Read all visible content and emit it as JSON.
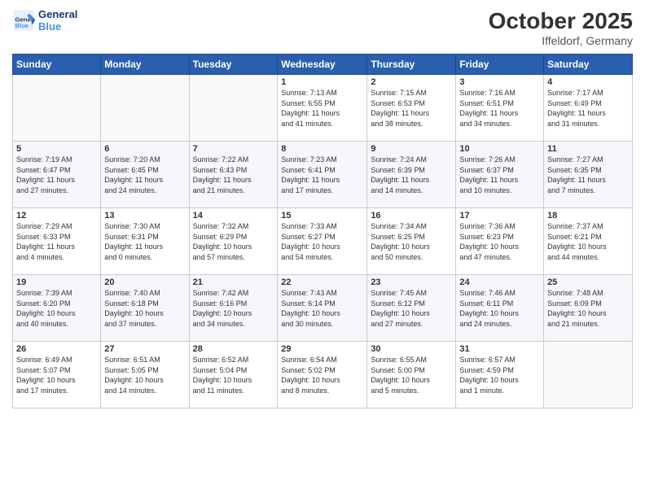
{
  "header": {
    "logo_line1": "General",
    "logo_line2": "Blue",
    "month_year": "October 2025",
    "location": "Iffeldorf, Germany"
  },
  "days_of_week": [
    "Sunday",
    "Monday",
    "Tuesday",
    "Wednesday",
    "Thursday",
    "Friday",
    "Saturday"
  ],
  "weeks": [
    [
      {
        "num": "",
        "info": ""
      },
      {
        "num": "",
        "info": ""
      },
      {
        "num": "",
        "info": ""
      },
      {
        "num": "1",
        "info": "Sunrise: 7:13 AM\nSunset: 6:55 PM\nDaylight: 11 hours\nand 41 minutes."
      },
      {
        "num": "2",
        "info": "Sunrise: 7:15 AM\nSunset: 6:53 PM\nDaylight: 11 hours\nand 38 minutes."
      },
      {
        "num": "3",
        "info": "Sunrise: 7:16 AM\nSunset: 6:51 PM\nDaylight: 11 hours\nand 34 minutes."
      },
      {
        "num": "4",
        "info": "Sunrise: 7:17 AM\nSunset: 6:49 PM\nDaylight: 11 hours\nand 31 minutes."
      }
    ],
    [
      {
        "num": "5",
        "info": "Sunrise: 7:19 AM\nSunset: 6:47 PM\nDaylight: 11 hours\nand 27 minutes."
      },
      {
        "num": "6",
        "info": "Sunrise: 7:20 AM\nSunset: 6:45 PM\nDaylight: 11 hours\nand 24 minutes."
      },
      {
        "num": "7",
        "info": "Sunrise: 7:22 AM\nSunset: 6:43 PM\nDaylight: 11 hours\nand 21 minutes."
      },
      {
        "num": "8",
        "info": "Sunrise: 7:23 AM\nSunset: 6:41 PM\nDaylight: 11 hours\nand 17 minutes."
      },
      {
        "num": "9",
        "info": "Sunrise: 7:24 AM\nSunset: 6:39 PM\nDaylight: 11 hours\nand 14 minutes."
      },
      {
        "num": "10",
        "info": "Sunrise: 7:26 AM\nSunset: 6:37 PM\nDaylight: 11 hours\nand 10 minutes."
      },
      {
        "num": "11",
        "info": "Sunrise: 7:27 AM\nSunset: 6:35 PM\nDaylight: 11 hours\nand 7 minutes."
      }
    ],
    [
      {
        "num": "12",
        "info": "Sunrise: 7:29 AM\nSunset: 6:33 PM\nDaylight: 11 hours\nand 4 minutes."
      },
      {
        "num": "13",
        "info": "Sunrise: 7:30 AM\nSunset: 6:31 PM\nDaylight: 11 hours\nand 0 minutes."
      },
      {
        "num": "14",
        "info": "Sunrise: 7:32 AM\nSunset: 6:29 PM\nDaylight: 10 hours\nand 57 minutes."
      },
      {
        "num": "15",
        "info": "Sunrise: 7:33 AM\nSunset: 6:27 PM\nDaylight: 10 hours\nand 54 minutes."
      },
      {
        "num": "16",
        "info": "Sunrise: 7:34 AM\nSunset: 6:25 PM\nDaylight: 10 hours\nand 50 minutes."
      },
      {
        "num": "17",
        "info": "Sunrise: 7:36 AM\nSunset: 6:23 PM\nDaylight: 10 hours\nand 47 minutes."
      },
      {
        "num": "18",
        "info": "Sunrise: 7:37 AM\nSunset: 6:21 PM\nDaylight: 10 hours\nand 44 minutes."
      }
    ],
    [
      {
        "num": "19",
        "info": "Sunrise: 7:39 AM\nSunset: 6:20 PM\nDaylight: 10 hours\nand 40 minutes."
      },
      {
        "num": "20",
        "info": "Sunrise: 7:40 AM\nSunset: 6:18 PM\nDaylight: 10 hours\nand 37 minutes."
      },
      {
        "num": "21",
        "info": "Sunrise: 7:42 AM\nSunset: 6:16 PM\nDaylight: 10 hours\nand 34 minutes."
      },
      {
        "num": "22",
        "info": "Sunrise: 7:43 AM\nSunset: 6:14 PM\nDaylight: 10 hours\nand 30 minutes."
      },
      {
        "num": "23",
        "info": "Sunrise: 7:45 AM\nSunset: 6:12 PM\nDaylight: 10 hours\nand 27 minutes."
      },
      {
        "num": "24",
        "info": "Sunrise: 7:46 AM\nSunset: 6:11 PM\nDaylight: 10 hours\nand 24 minutes."
      },
      {
        "num": "25",
        "info": "Sunrise: 7:48 AM\nSunset: 6:09 PM\nDaylight: 10 hours\nand 21 minutes."
      }
    ],
    [
      {
        "num": "26",
        "info": "Sunrise: 6:49 AM\nSunset: 5:07 PM\nDaylight: 10 hours\nand 17 minutes."
      },
      {
        "num": "27",
        "info": "Sunrise: 6:51 AM\nSunset: 5:05 PM\nDaylight: 10 hours\nand 14 minutes."
      },
      {
        "num": "28",
        "info": "Sunrise: 6:52 AM\nSunset: 5:04 PM\nDaylight: 10 hours\nand 11 minutes."
      },
      {
        "num": "29",
        "info": "Sunrise: 6:54 AM\nSunset: 5:02 PM\nDaylight: 10 hours\nand 8 minutes."
      },
      {
        "num": "30",
        "info": "Sunrise: 6:55 AM\nSunset: 5:00 PM\nDaylight: 10 hours\nand 5 minutes."
      },
      {
        "num": "31",
        "info": "Sunrise: 6:57 AM\nSunset: 4:59 PM\nDaylight: 10 hours\nand 1 minute."
      },
      {
        "num": "",
        "info": ""
      }
    ]
  ]
}
